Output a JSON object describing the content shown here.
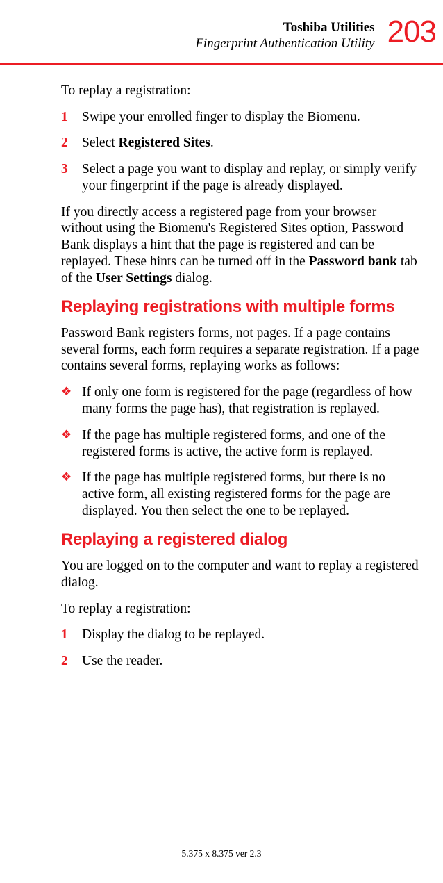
{
  "header": {
    "chapter": "Toshiba Utilities",
    "section": "Fingerprint Authentication Utility",
    "page_number": "203"
  },
  "intro": "To replay a registration:",
  "steps_a": [
    {
      "num": "1",
      "text": "Swipe your enrolled finger to display the Biomenu."
    },
    {
      "num": "2",
      "text_pre": "Select ",
      "bold": "Registered Sites",
      "text_post": "."
    },
    {
      "num": "3",
      "text": "Select a page you want to display and replay, or simply verify your fingerprint if the page is already displayed."
    }
  ],
  "para_hint_pre": "If you directly access a registered page from your browser without using the Biomenu's Registered Sites option, Password Bank displays a hint that the page is registered and can be replayed. These hints can be turned off in the ",
  "para_hint_b1": "Password bank",
  "para_hint_mid": " tab of the ",
  "para_hint_b2": "User Settings",
  "para_hint_post": " dialog.",
  "heading1": "Replaying registrations with multiple forms",
  "para_forms": "Password Bank registers forms, not pages. If a page contains several forms, each form requires a separate registration. If a page contains several forms, replaying works as follows:",
  "bullets": [
    "If only one form is registered for the page (regardless of how many forms the page has), that registration is replayed.",
    "If the page has multiple registered forms, and one of the registered forms is active, the active form is replayed.",
    "If the page has multiple registered forms, but there is no active form, all existing registered forms for the page are displayed. You then select the one to be replayed."
  ],
  "heading2": "Replaying a registered dialog",
  "para_dialog": "You are logged on to the computer and want to replay a registered dialog.",
  "intro2": "To replay a registration:",
  "steps_b": [
    {
      "num": "1",
      "text": "Display the dialog to be replayed."
    },
    {
      "num": "2",
      "text": "Use the reader."
    }
  ],
  "footer": "5.375 x 8.375 ver 2.3",
  "bullet_glyph": "❖"
}
